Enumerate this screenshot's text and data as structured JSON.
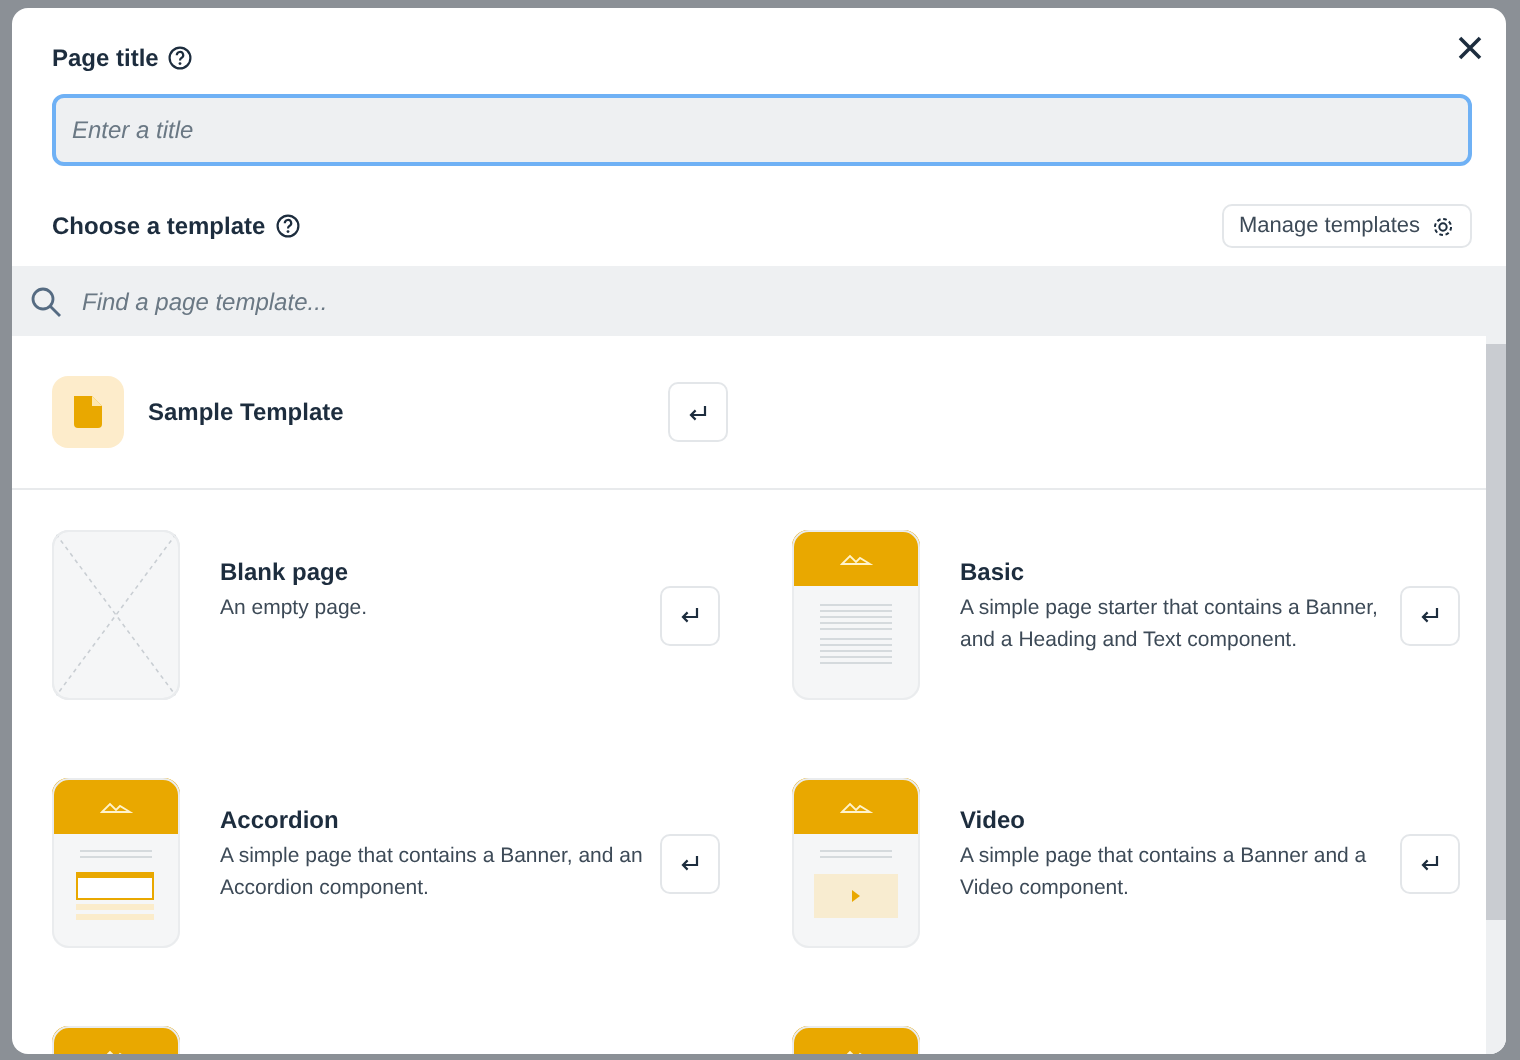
{
  "dialog": {
    "title_label": "Page title",
    "title_field": {
      "placeholder": "Enter a title",
      "focused": true
    },
    "template_label": "Choose a template",
    "manage_button": "Manage templates",
    "search": {
      "placeholder": "Find a page template..."
    }
  },
  "sample": {
    "name": "Sample Template"
  },
  "templates": [
    {
      "kind": "blank",
      "name": "Blank page",
      "description": "An empty page."
    },
    {
      "kind": "basic",
      "name": "Basic",
      "description": "A simple page starter that contains a Banner, and a Heading and Text component."
    },
    {
      "kind": "accordion",
      "name": "Accordion",
      "description": "A simple page that contains a Banner, and an Accordion component."
    },
    {
      "kind": "video",
      "name": "Video",
      "description": "A simple page that contains a Banner and a Video component."
    },
    {
      "kind": "banner"
    },
    {
      "kind": "banner"
    }
  ]
}
